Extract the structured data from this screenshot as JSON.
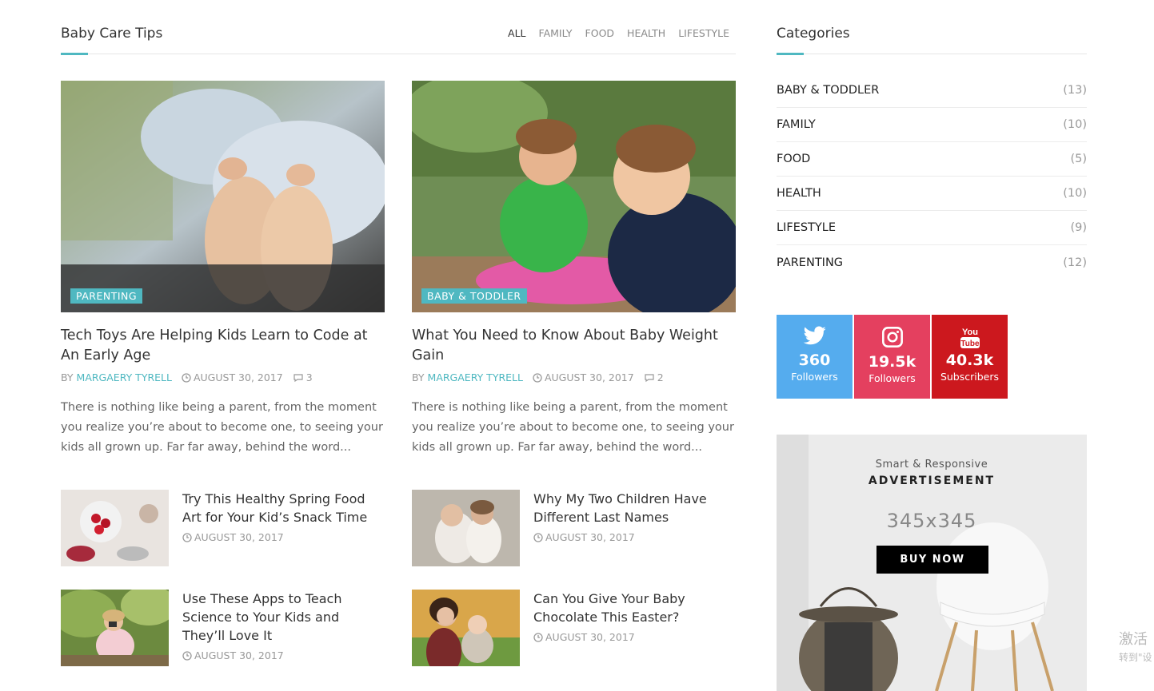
{
  "section": {
    "title": "Baby Care Tips",
    "tabs": [
      "ALL",
      "FAMILY",
      "FOOD",
      "HEALTH",
      "LIFESTYLE"
    ],
    "active_tab": "ALL"
  },
  "featured": [
    {
      "category": "PARENTING",
      "title": "Tech Toys Are Helping Kids Learn to Code at An Early Age",
      "by": "BY",
      "author": "MARGAERY TYRELL",
      "date": "AUGUST 30, 2017",
      "comments": "3",
      "excerpt": "There is nothing like being a parent, from the moment you realize you’re about to become one, to seeing your kids all grown up. Far far away, behind the word..."
    },
    {
      "category": "BABY & TODDLER",
      "title": "What You Need to Know About Baby Weight Gain",
      "by": "BY",
      "author": "MARGAERY TYRELL",
      "date": "AUGUST 30, 2017",
      "comments": "2",
      "excerpt": "There is nothing like being a parent, from the moment you realize you’re about to become one, to seeing your kids all grown up. Far far away, behind the word..."
    }
  ],
  "small_posts": [
    {
      "title": "Try This Healthy Spring Food Art for Your Kid’s Snack Time",
      "date": "AUGUST 30, 2017"
    },
    {
      "title": "Why My Two Children Have Different Last Names",
      "date": "AUGUST 30, 2017"
    },
    {
      "title": "Use These Apps to Teach Science to Your Kids and They’ll Love It",
      "date": "AUGUST 30, 2017"
    },
    {
      "title": "Can You Give Your Baby Chocolate This Easter?",
      "date": "AUGUST 30, 2017"
    }
  ],
  "sidebar": {
    "categories_title": "Categories",
    "categories": [
      {
        "name": "BABY & TODDLER",
        "count": "(13)"
      },
      {
        "name": "FAMILY",
        "count": "(10)"
      },
      {
        "name": "FOOD",
        "count": "(5)"
      },
      {
        "name": "HEALTH",
        "count": "(10)"
      },
      {
        "name": "LIFESTYLE",
        "count": "(9)"
      },
      {
        "name": "PARENTING",
        "count": "(12)"
      }
    ],
    "social": [
      {
        "network": "twitter",
        "icon": "twitter-icon",
        "count": "360",
        "label": "Followers",
        "color": "#55acee"
      },
      {
        "network": "instagram",
        "icon": "instagram-icon",
        "count": "19.5k",
        "label": "Followers",
        "color": "#e4405f"
      },
      {
        "network": "youtube",
        "icon": "youtube-icon",
        "count": "40.3k",
        "label": "Subscribers",
        "color": "#cc181e"
      }
    ],
    "ad": {
      "line1": "Smart & Responsive",
      "line2": "ADVERTISEMENT",
      "size": "345x345",
      "button": "BUY NOW"
    }
  },
  "watermark": {
    "line1": "激活",
    "line2": "转到\"设"
  },
  "colors": {
    "accent": "#4fb8c1",
    "text": "#333333",
    "muted": "#999999"
  }
}
